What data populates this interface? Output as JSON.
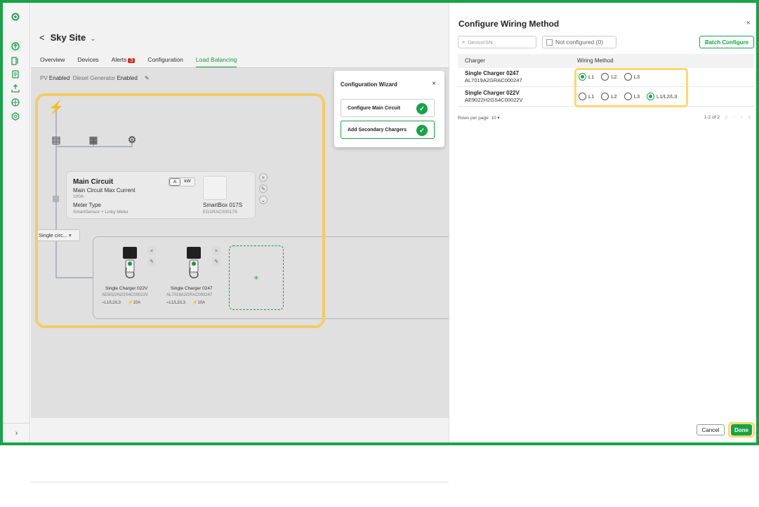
{
  "app": {
    "accent": "#17a348",
    "highlight": "#ffd86b"
  },
  "rail": {
    "logo_icon": "settings-gear-icon",
    "items": [
      "overview-icon",
      "devices-icon",
      "document-icon",
      "upload-icon",
      "globe-icon",
      "settings-icon"
    ],
    "expand": "›"
  },
  "site": {
    "back": "<",
    "name": "Sky Site",
    "dropdown": "⌄"
  },
  "tabs": [
    {
      "label": "Overview"
    },
    {
      "label": "Devices"
    },
    {
      "label": "Alerts",
      "badge": "3"
    },
    {
      "label": "Configuration"
    },
    {
      "label": "Load Balancing",
      "active": true
    }
  ],
  "status": {
    "pv_label": "PV",
    "pv_value": "Enabled",
    "diesel_label": "Diesel Generator",
    "diesel_value": "Enabled",
    "edit_icon": "pencil-icon"
  },
  "main_circuit": {
    "title": "Main Circuit",
    "max_current_label": "Main Circuit Max Current",
    "max_current_value": "100A",
    "meter_type_label": "Meter Type",
    "meter_type_value": "SmartSensor + Linky Meter",
    "unit_a": "A",
    "unit_kw": "kW",
    "smartbox_name": "SmartBox 017S",
    "smartbox_sn": "EG1RAC00017S"
  },
  "secondary_select": {
    "value": "Single circ..."
  },
  "chargers_canvas": [
    {
      "name": "Single Charger 022V",
      "sn": "AE9022H2GS4C00022V",
      "phase": "L1/L2/L3",
      "current": "10A"
    },
    {
      "name": "Single Charger 0247",
      "sn": "AL7019A2GRAC000247",
      "phase": "L1/L2/L3",
      "current": "10A"
    }
  ],
  "add_symbol": "+",
  "wizard": {
    "title": "Configuration Wizard",
    "close": "×",
    "steps": [
      {
        "label": "Configure Main Circuit",
        "done": true
      },
      {
        "label": "Add Secondary Chargers",
        "done": true,
        "active": true
      }
    ]
  },
  "panel": {
    "title": "Configure Wiring Method",
    "close": "×",
    "search_placeholder": "Device/SN",
    "filter_label": "Not configured (0)",
    "batch_label": "Batch Configure",
    "col_charger": "Charger",
    "col_wiring": "Wiring Method",
    "rows": [
      {
        "name": "Single Charger 0247",
        "sn": "AL7019A2GRAC000247",
        "options": [
          "L1",
          "L2",
          "L3"
        ],
        "selected": "L1"
      },
      {
        "name": "Single Charger 022V",
        "sn": "AE9022H2GS4C00022V",
        "options": [
          "L1",
          "L2",
          "L3",
          "L1/L2/L3"
        ],
        "selected": "L1/L2/L3"
      }
    ],
    "rows_per_page_label": "Rows per page:",
    "rows_per_page_value": "10",
    "range": "1-2 of 2",
    "cancel": "Cancel",
    "done": "Done"
  }
}
